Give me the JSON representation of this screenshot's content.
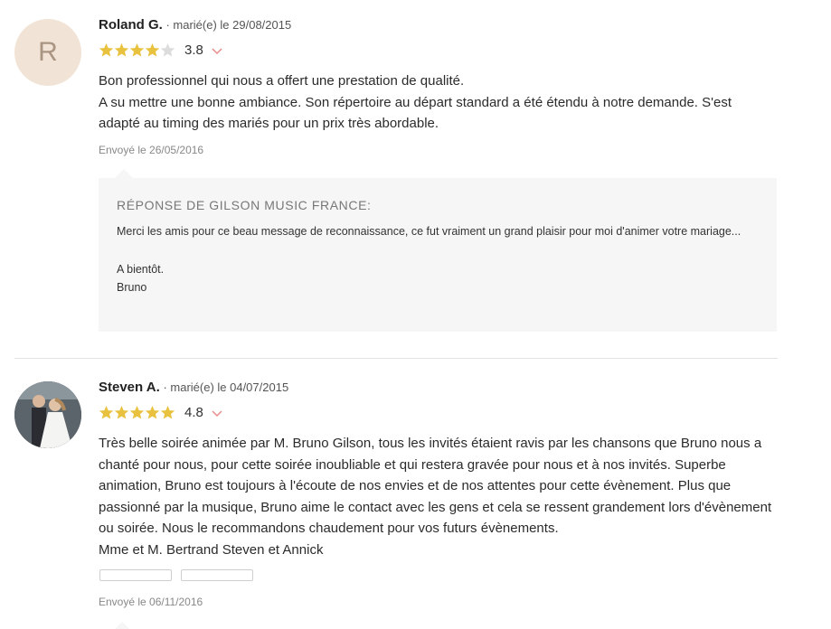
{
  "reviews": [
    {
      "avatar_letter": "R",
      "name": "Roland G.",
      "married": "· marié(e) le 29/08/2015",
      "score": "3.8",
      "stars": 3.8,
      "lines": [
        "Bon professionnel qui nous a offert une prestation de qualité.",
        "A su mettre une bonne ambiance. Son répertoire au départ standard a été étendu à notre demande. S'est adapté au timing des mariés pour un prix très abordable."
      ],
      "sent": "Envoyé le 26/05/2016",
      "reply": {
        "title": "RÉPONSE DE GILSON MUSIC FRANCE:",
        "p1": "Merci les amis pour ce beau message de reconnaissance, ce fut vraiment un grand plaisir pour moi d'animer votre mariage...",
        "p2": "A bientôt.",
        "p3": "Bruno"
      }
    },
    {
      "avatar_icon": "wedding-couple-photo",
      "name": "Steven A.",
      "married": "· marié(e) le 04/07/2015",
      "score": "4.8",
      "stars": 4.8,
      "lines": [
        "Très belle soirée animée par M. Bruno Gilson, tous les invités étaient ravis par les chansons que Bruno nous a chanté pour nous, pour cette soirée inoubliable et qui restera gravée pour nous et à nos invités. Superbe animation, Bruno est toujours à l'écoute de nos envies et de nos attentes pour cette évènement. Plus que passionné par la musique, Bruno aime le contact avec les gens et cela se ressent grandement lors d'évènement ou soirée. Nous le recommandons chaudement pour vos futurs évènements.",
        "Mme et M. Bertrand Steven et Annick"
      ],
      "sent": "Envoyé le 06/11/2016"
    }
  ],
  "colors": {
    "star_filled": "#e8c23f",
    "star_empty": "#dcdcdc",
    "chevron": "#e98b8b",
    "avatar_bg": "#f1e4d6"
  }
}
